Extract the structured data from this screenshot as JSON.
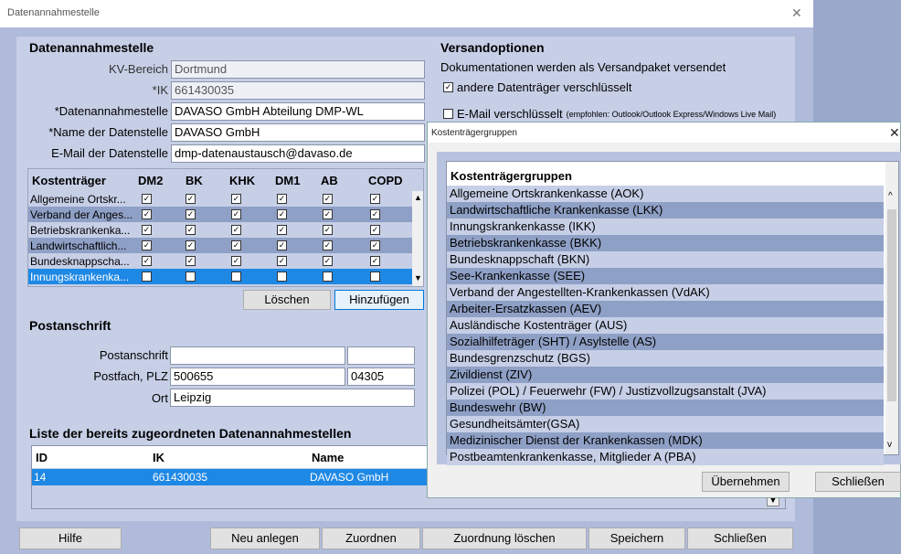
{
  "window": {
    "title": "Datenannahmestelle"
  },
  "daten": {
    "heading": "Datenannahmestelle",
    "kv_label": "KV-Bereich",
    "kv_value": "Dortmund",
    "ik_label": "*IK",
    "ik_value": "661430035",
    "dan_label": "*Datenannahmestelle",
    "dan_value": "DAVASO GmbH Abteilung DMP-WL",
    "name_label": "*Name der Datenstelle",
    "name_value": "DAVASO GmbH",
    "email_label": "E-Mail der Datenstelle",
    "email_value": "dmp-datenaustausch@davaso.de"
  },
  "versand": {
    "heading": "Versandoptionen",
    "desc": "Dokumentationen werden als Versandpaket versendet",
    "opt1": "andere Datenträger verschlüsselt",
    "opt2": "E-Mail verschlüsselt",
    "opt2_hint": "(empfohlen: Outlook/Outlook Express/Windows Live Mail)"
  },
  "grid": {
    "headers": [
      "Kostenträger",
      "DM2",
      "BK",
      "KHK",
      "DM1",
      "AB",
      "COPD"
    ],
    "rows": [
      {
        "name": "Allgemeine Ortskr...",
        "checks": [
          true,
          true,
          true,
          true,
          true,
          true
        ]
      },
      {
        "name": "Verband der Anges...",
        "checks": [
          true,
          true,
          true,
          true,
          true,
          true
        ]
      },
      {
        "name": "Betriebskrankenka...",
        "checks": [
          true,
          true,
          true,
          true,
          true,
          true
        ]
      },
      {
        "name": "Landwirtschaftlich...",
        "checks": [
          true,
          true,
          true,
          true,
          true,
          true
        ]
      },
      {
        "name": "Bundesknappscha...",
        "checks": [
          true,
          true,
          true,
          true,
          true,
          true
        ]
      },
      {
        "name": "Innungskrankenka...",
        "checks": [
          false,
          false,
          false,
          false,
          false,
          false
        ]
      }
    ],
    "delete_label": "Löschen",
    "add_label": "Hinzufügen"
  },
  "post": {
    "heading": "Postanschrift",
    "addr_label": "Postanschrift",
    "pf_label": "Postfach, PLZ",
    "pf_value": "500655",
    "plz_value": "04305",
    "ort_label": "Ort",
    "ort_value": "Leipzig"
  },
  "liste": {
    "heading": "Liste der bereits zugeordneten Datenannahmestellen",
    "col_id": "ID",
    "col_ik": "IK",
    "col_name": "Name",
    "row_id": "14",
    "row_ik": "661430035",
    "row_name": "DAVASO GmbH"
  },
  "bottom": {
    "help": "Hilfe",
    "new": "Neu anlegen",
    "assign": "Zuordnen",
    "unassign": "Zuordnung löschen",
    "save": "Speichern",
    "close": "Schließen"
  },
  "dialog": {
    "title": "Kostenträgergruppen",
    "header": "Kostenträgergruppen",
    "items": [
      "Allgemeine Ortskrankenkasse (AOK)",
      "Landwirtschaftliche Krankenkasse (LKK)",
      "Innungskrankenkasse (IKK)",
      "Betriebskrankenkasse (BKK)",
      "Bundesknappschaft (BKN)",
      "See-Krankenkasse (SEE)",
      "Verband der Angestellten-Krankenkassen (VdAK)",
      "Arbeiter-Ersatzkassen (AEV)",
      "Ausländische Kostenträger (AUS)",
      "Sozialhilfeträger (SHT) / Asylstelle (AS)",
      "Bundesgrenzschutz (BGS)",
      "Zivildienst (ZIV)",
      "Polizei (POL) / Feuerwehr (FW) / Justizvollzugsanstalt (JVA)",
      "Bundeswehr (BW)",
      "Gesundheitsämter(GSA)",
      "Medizinischer Dienst der Krankenkassen (MDK)",
      "Postbeamtenkrankenkasse, Mitglieder A (PBA)"
    ],
    "ok": "Übernehmen",
    "close": "Schließen"
  }
}
